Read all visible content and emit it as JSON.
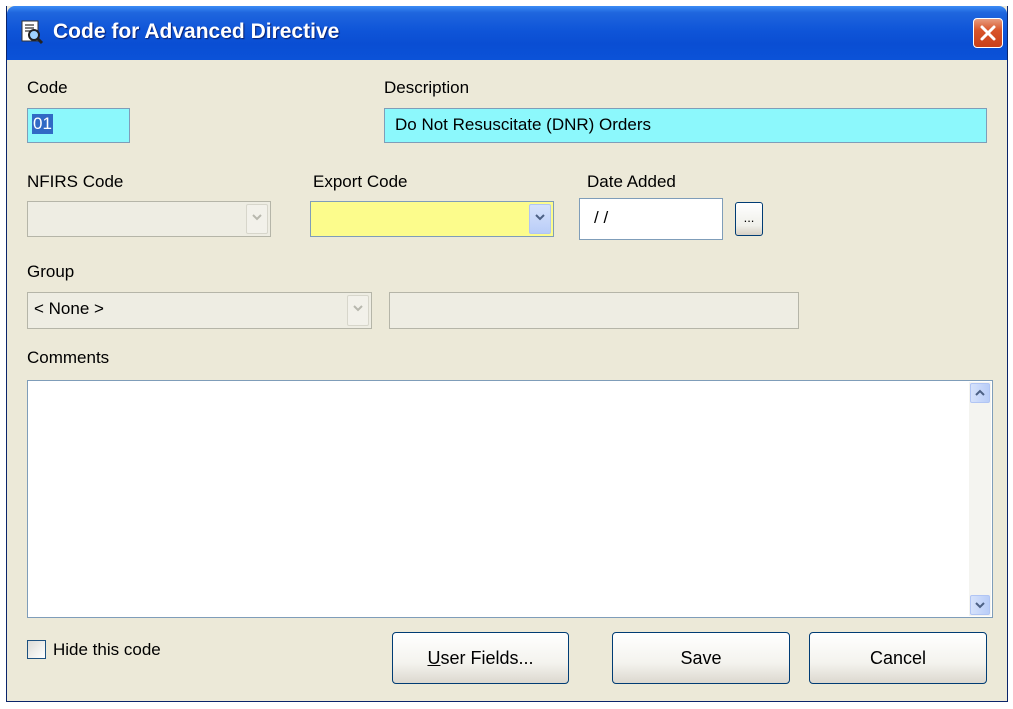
{
  "window": {
    "title": "Code for Advanced Directive",
    "title_icon": "code-lookup-icon",
    "close_icon": "close-icon"
  },
  "code": {
    "label": "Code",
    "value": "01"
  },
  "description": {
    "label": "Description",
    "value": "Do Not Resuscitate (DNR) Orders"
  },
  "nfirs": {
    "label": "NFIRS Code",
    "value": ""
  },
  "export": {
    "label": "Export Code",
    "value": ""
  },
  "date_added": {
    "label": "Date Added",
    "value": " / /",
    "picker_label": "..."
  },
  "group": {
    "label": "Group",
    "value": "< None >",
    "description": ""
  },
  "comments": {
    "label": "Comments",
    "value": ""
  },
  "hide_code": {
    "label": "Hide this code",
    "checked": false
  },
  "buttons": {
    "user_fields_accesskey": "U",
    "user_fields_rest": "ser Fields...",
    "save": "Save",
    "cancel": "Cancel"
  },
  "colors": {
    "required_field": "#8CF8FC",
    "highlight_field": "#FCFC8C",
    "titlebar": "#0A4ED3",
    "dialog_background": "#ECE9D8"
  }
}
